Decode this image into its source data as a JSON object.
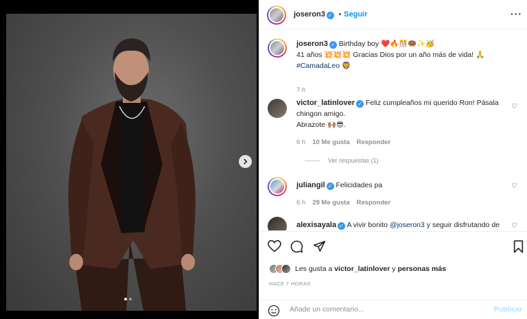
{
  "post": {
    "username": "joseron3",
    "follow_label": "Seguir",
    "more_label": "···",
    "carousel": {
      "active_index": 0,
      "total": 2
    }
  },
  "caption": {
    "username": "joseron3",
    "line1": "Birthday boy ❤️🔥🎊🍩✨🥳",
    "line2": "41 años 💥💥💥 Gracias Dios por un año más de vida! 🙏",
    "hashtag": "#CamadaLeo",
    "hashtag_emoji": "🦁",
    "time": "7 h"
  },
  "comments": [
    {
      "username": "victor_latinlover",
      "line1": "Feliz cumpleaños mi querido Ron! Pásala",
      "line2": "chingon amigo.",
      "line3": "Abrazote 🙌🏽😎.",
      "time": "6 h",
      "likes": "10 Me gusta",
      "reply": "Responder",
      "view_replies": "Ver respuestas (1)"
    },
    {
      "username": "juliangil",
      "text": "Felicidades pa",
      "time": "6 h",
      "likes": "29 Me gusta",
      "reply": "Responder"
    },
    {
      "username": "alexisayala",
      "text_prefix": "A vivir bonito ",
      "mention": "@joseron3",
      "text_suffix": " y seguir disfrutando de"
    }
  ],
  "likes": {
    "prefix": "Les gusta a ",
    "user": "victor_latinlover",
    "joiner": " y ",
    "rest": "personas más"
  },
  "time_ago": "HACE 7 HORAS",
  "add_comment": {
    "placeholder": "Añade un comentario...",
    "post_label": "Publicar"
  },
  "colors": {
    "link_blue": "#0095f6",
    "verified": "#3897f0",
    "hashtag": "#00376b",
    "muted": "#8e8e8e",
    "suit": "#4a2a20"
  }
}
